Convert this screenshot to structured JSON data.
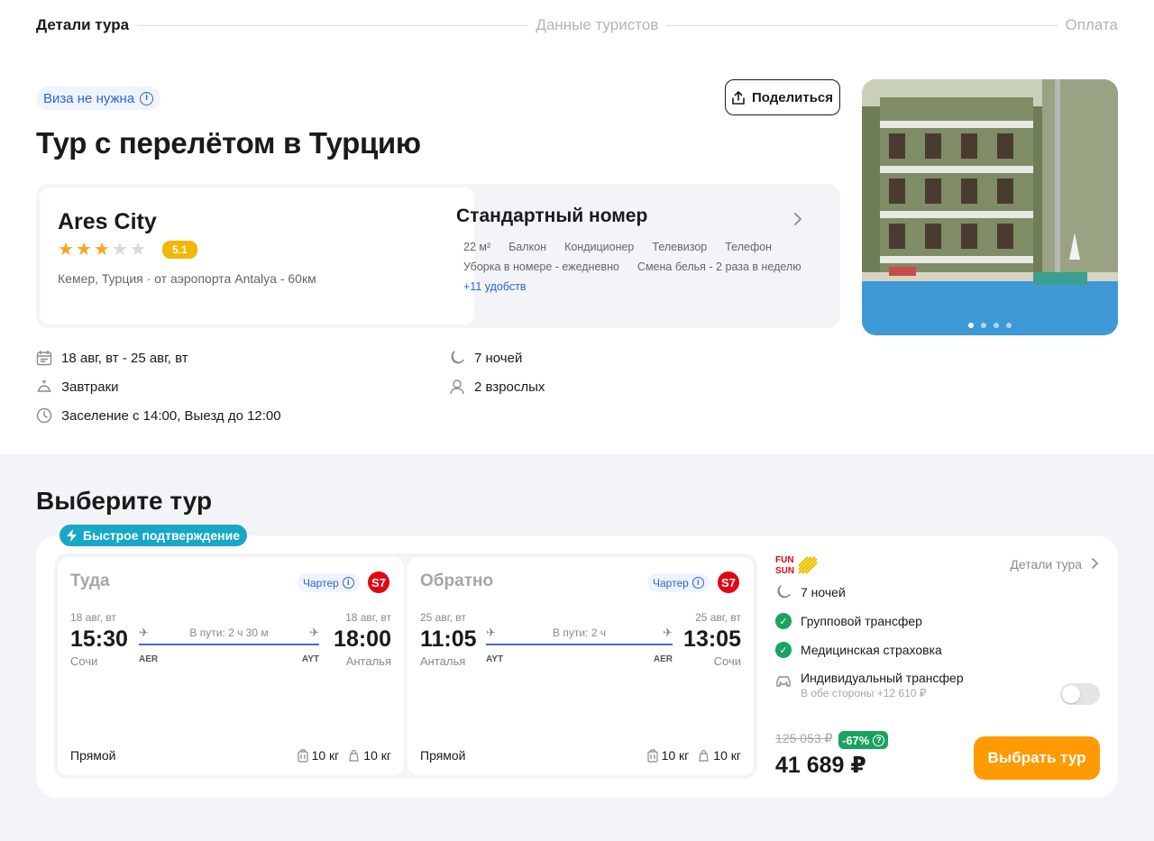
{
  "stepper": {
    "step1": "Детали тура",
    "step2": "Данные туристов",
    "step3": "Оплата"
  },
  "header": {
    "visa": "Виза не нужна",
    "share": "Поделиться",
    "title": "Тур с перелётом в Турцию"
  },
  "hotel": {
    "name": "Ares City",
    "stars": 3,
    "rating": "5.1",
    "location": "Кемер, Турция · от аэропорта Antalya - 60км"
  },
  "room": {
    "title": "Стандартный номер",
    "amenities": [
      "22 м²",
      "Балкон",
      "Кондиционер",
      "Телевизор",
      "Телефон",
      "Уборка в номере - ежедневно",
      "Смена белья - 2 раза в неделю"
    ],
    "more": "+11 удобств"
  },
  "facts": {
    "dates": "18 авг, вт - 25 авг, вт",
    "meal": "Завтраки",
    "checkin": "Заселение с 14:00, Выезд до 12:00",
    "nights": "7 ночей",
    "guests": "2 взрослых"
  },
  "section": {
    "title": "Выберите тур"
  },
  "tour": {
    "badge": "Быстрое подтверждение",
    "outbound": {
      "title": "Туда",
      "charter": "Чартер",
      "airline_logo": "S7",
      "dep_date": "18 авг, вт",
      "dep_time": "15:30",
      "dep_city": "Сочи",
      "dep_code": "AER",
      "arr_date": "18 авг, вт",
      "arr_time": "18:00",
      "arr_city": "Анталья",
      "arr_code": "AYT",
      "duration": "В пути: 2 ч 30 м",
      "type": "Прямой",
      "bag1": "10 кг",
      "bag2": "10 кг"
    },
    "inbound": {
      "title": "Обратно",
      "charter": "Чартер",
      "airline_logo": "S7",
      "dep_date": "25 авг, вт",
      "dep_time": "11:05",
      "dep_city": "Анталья",
      "dep_code": "AYT",
      "arr_date": "25 авг, вт",
      "arr_time": "13:05",
      "arr_city": "Сочи",
      "arr_code": "AER",
      "duration": "В пути: 2 ч",
      "type": "Прямой",
      "bag1": "10 кг",
      "bag2": "10 кг"
    },
    "operator": "FUN&SUN",
    "details_link": "Детали тура",
    "nights": "7 ночей",
    "group_transfer": "Групповой трансфер",
    "insurance": "Медицинская страховка",
    "individual_transfer": "Индивидуальный трансфер",
    "individual_transfer_note": "В обе стороны +12 610 ₽",
    "individual_transfer_on": false,
    "old_price": "125 053 ₽",
    "discount": "-67%",
    "price": "41 689 ₽",
    "select": "Выбрать тур"
  },
  "colors": {
    "accent": "#ff9a00",
    "link": "#2f64d8",
    "badge": "#17a8c8",
    "success": "#19a35f",
    "rating": "#f2b705"
  }
}
